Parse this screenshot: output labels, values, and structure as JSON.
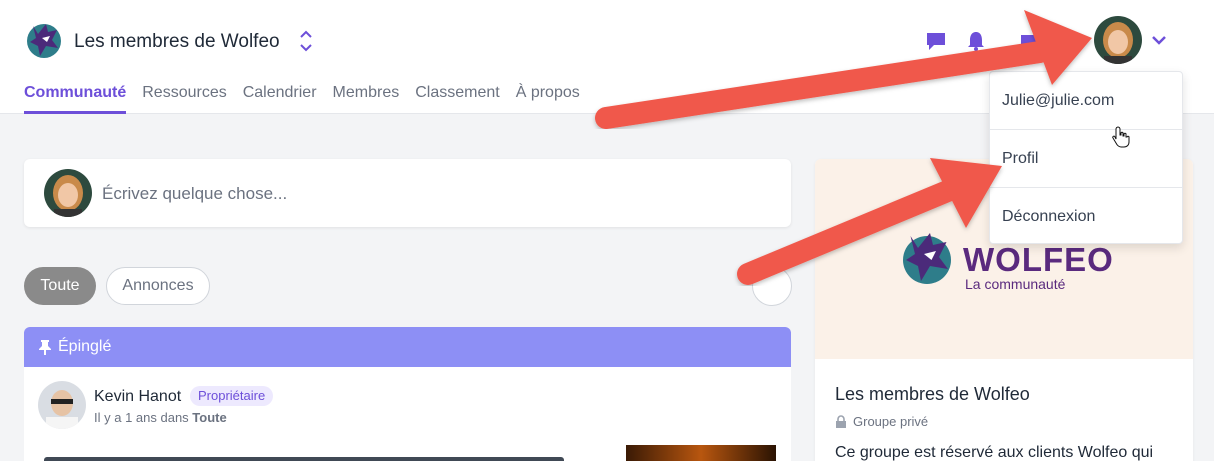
{
  "header": {
    "group_name": "Les membres de Wolfeo",
    "icons": [
      "chat-icon",
      "bell-icon",
      "calendar-icon"
    ]
  },
  "nav": {
    "items": [
      {
        "label": "Communauté",
        "active": true
      },
      {
        "label": "Ressources"
      },
      {
        "label": "Calendrier"
      },
      {
        "label": "Membres"
      },
      {
        "label": "Classement"
      },
      {
        "label": "À propos"
      }
    ]
  },
  "composer": {
    "placeholder": "Écrivez quelque chose..."
  },
  "filters": {
    "all": "Toute",
    "announcements": "Annonces"
  },
  "post": {
    "pinned_label": "Épinglé",
    "author": "Kevin Hanot",
    "badge": "Propriétaire",
    "meta_prefix": "Il y a 1 ans dans",
    "meta_space": "Toute"
  },
  "side_card": {
    "brand": "WOLFEO",
    "brand_sub": "La communauté",
    "title": "Les membres de Wolfeo",
    "privacy": "Groupe privé",
    "description": "Ce groupe est réservé aux clients Wolfeo qui"
  },
  "dropdown": {
    "items": [
      "Julie@julie.com",
      "Profil",
      "Déconnexion"
    ]
  },
  "colors": {
    "accent": "#6d4fd9",
    "pin_bar": "#8d8ff5",
    "arrow": "#f0594b",
    "brand": "#5a2a7e"
  }
}
